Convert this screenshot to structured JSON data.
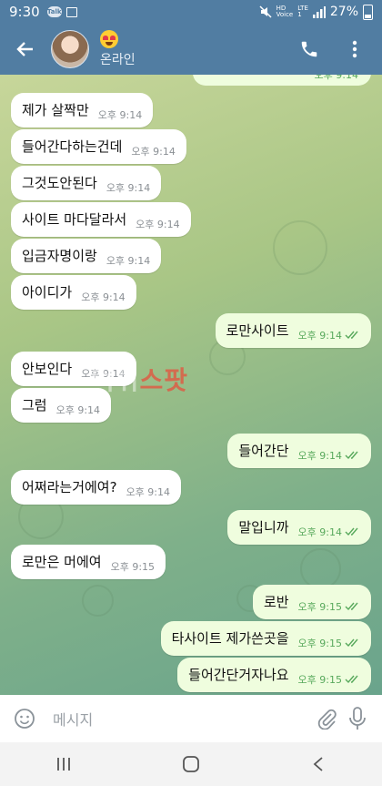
{
  "status_bar": {
    "time": "9:30",
    "badge": "Talk",
    "volte": "HD",
    "volte_sub": "Voice",
    "network": "LTE",
    "network_sub": "1",
    "battery": "27%"
  },
  "header": {
    "status": "온라인",
    "icons": [
      "back-arrow-icon",
      "avatar",
      "heart-eyes-emoji",
      "phone-icon",
      "more-vert-icon"
    ]
  },
  "messages": [
    {
      "side": "in",
      "text": "제가 살짝만",
      "time": "오후 9:14"
    },
    {
      "side": "in",
      "text": "들어간다하는건데",
      "time": "오후 9:14"
    },
    {
      "side": "in",
      "text": "그것도안된다",
      "time": "오후 9:14"
    },
    {
      "side": "in",
      "text": "사이트 마다달라서",
      "time": "오후 9:14"
    },
    {
      "side": "in",
      "text": "입금자명이랑",
      "time": "오후 9:14"
    },
    {
      "side": "in",
      "text": "아이디가",
      "time": "오후 9:14"
    },
    {
      "side": "out",
      "text": "로만사이트",
      "time": "오후 9:14"
    },
    {
      "side": "in",
      "text": "안보인다",
      "time": "오후 9:14"
    },
    {
      "side": "in",
      "text": "그럼",
      "time": "오후 9:14"
    },
    {
      "side": "out",
      "text": "들어간단",
      "time": "오후 9:14"
    },
    {
      "side": "in",
      "text": "어쩌라는거에여?",
      "time": "오후 9:14"
    },
    {
      "side": "out",
      "text": "말입니까",
      "time": "오후 9:14"
    },
    {
      "side": "in",
      "text": "로만은 머에여",
      "time": "오후 9:15"
    },
    {
      "side": "out",
      "text": "로반",
      "time": "오후 9:15"
    },
    {
      "side": "out",
      "text": "타사이트 제가쓴곳을",
      "time": "오후 9:15"
    },
    {
      "side": "out",
      "text": "들어간단거자나요",
      "time": "오후 9:15"
    }
  ],
  "partial_top_time": "오후 9:14",
  "watermark": {
    "part1": "먹튀",
    "part2": "스팟"
  },
  "input": {
    "placeholder": "메시지"
  },
  "colors": {
    "header": "#517da2",
    "outgoing": "#effdde",
    "incoming": "#ffffff",
    "ticks": "#58a95c"
  }
}
